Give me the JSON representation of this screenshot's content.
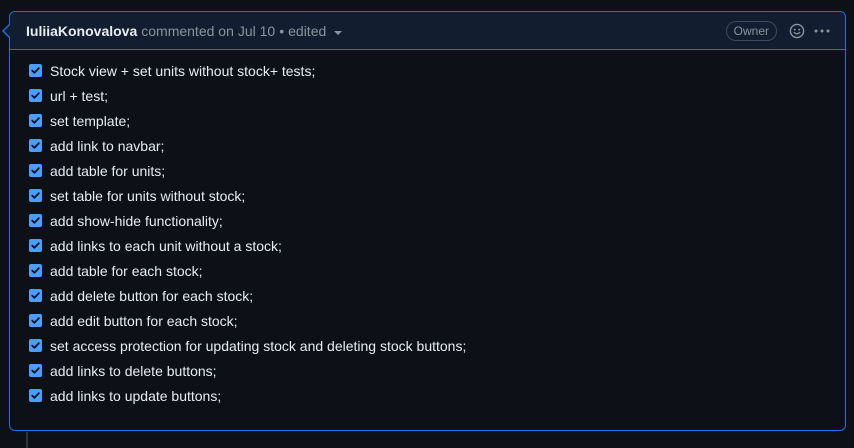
{
  "comment": {
    "author": "IuliiaKonovalova",
    "action": "commented on",
    "date": "Jul 10",
    "separator": "•",
    "edited_label": "edited",
    "badge": "Owner",
    "icons": {
      "reaction": "smiley-icon",
      "menu": "kebab-horizontal-icon",
      "edited_dropdown": "caret-down-icon",
      "checkbox": "checkbox-checked-icon"
    },
    "colors": {
      "accent_border": "#1f6feb",
      "header_bg": "#121d2f",
      "checkbox": "#4a9eff",
      "text": "#e6edf3",
      "muted": "#8b949e"
    },
    "tasks": [
      {
        "label": "Stock view + set units without stock+ tests;",
        "checked": true
      },
      {
        "label": "url + test;",
        "checked": true
      },
      {
        "label": "set template;",
        "checked": true
      },
      {
        "label": "add link to navbar;",
        "checked": true
      },
      {
        "label": "add table for units;",
        "checked": true
      },
      {
        "label": "set table for units without stock;",
        "checked": true
      },
      {
        "label": "add show-hide functionality;",
        "checked": true
      },
      {
        "label": "add links to each unit without a stock;",
        "checked": true
      },
      {
        "label": "add table for each stock;",
        "checked": true
      },
      {
        "label": "add delete button for each stock;",
        "checked": true
      },
      {
        "label": "add edit button for each stock;",
        "checked": true
      },
      {
        "label": "set access protection for updating stock and deleting stock buttons;",
        "checked": true
      },
      {
        "label": "add links to delete buttons;",
        "checked": true
      },
      {
        "label": "add links to update buttons;",
        "checked": true
      }
    ]
  }
}
